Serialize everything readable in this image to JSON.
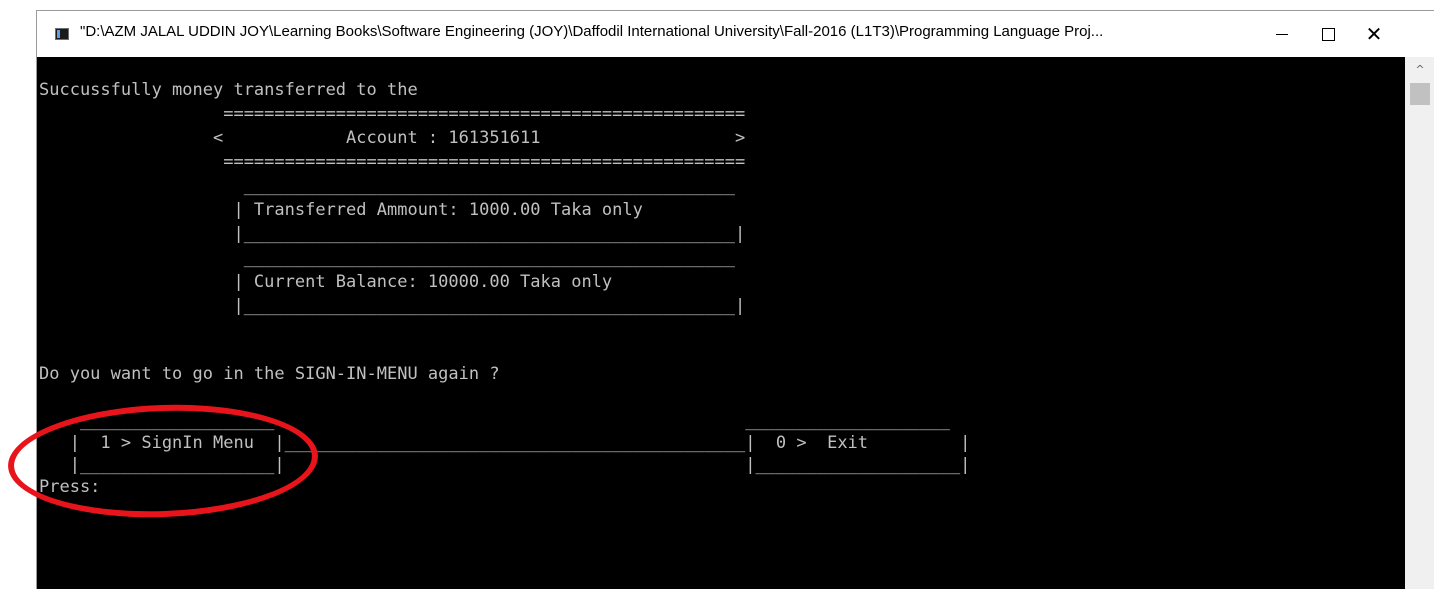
{
  "window": {
    "title": "\"D:\\AZM JALAL UDDIN JOY\\Learning Books\\Software Engineering (JOY)\\Daffodil International University\\Fall-2016 (L1T3)\\Programming Language Proj...",
    "minimize_glyph": "—",
    "close_glyph": "✕"
  },
  "console": {
    "lines": [
      "Succussfully money transferred to the",
      "                  ===================================================",
      "                 <            Account : 161351611                   >",
      "                  ===================================================",
      "                    ________________________________________________",
      "                   | Transferred Ammount: 1000.00 Taka only         ",
      "                   |________________________________________________|",
      "                    ________________________________________________",
      "                   | Current Balance: 10000.00 Taka only            ",
      "                   |________________________________________________|",
      "",
      "Do you want to go in the SIGN-IN-MENU again ?",
      "",
      "    ___________________                                              ____________________",
      "   |  1 > SignIn Menu  |_____________________________________________|  0 >  Exit         |",
      "   |___________________|                                             |____________________|",
      "Press:"
    ]
  },
  "scrollbar": {
    "up_glyph": "^"
  },
  "colors": {
    "console_bg": "#000000",
    "console_text": "#c0c0c0",
    "annotation": "#e8141b"
  }
}
